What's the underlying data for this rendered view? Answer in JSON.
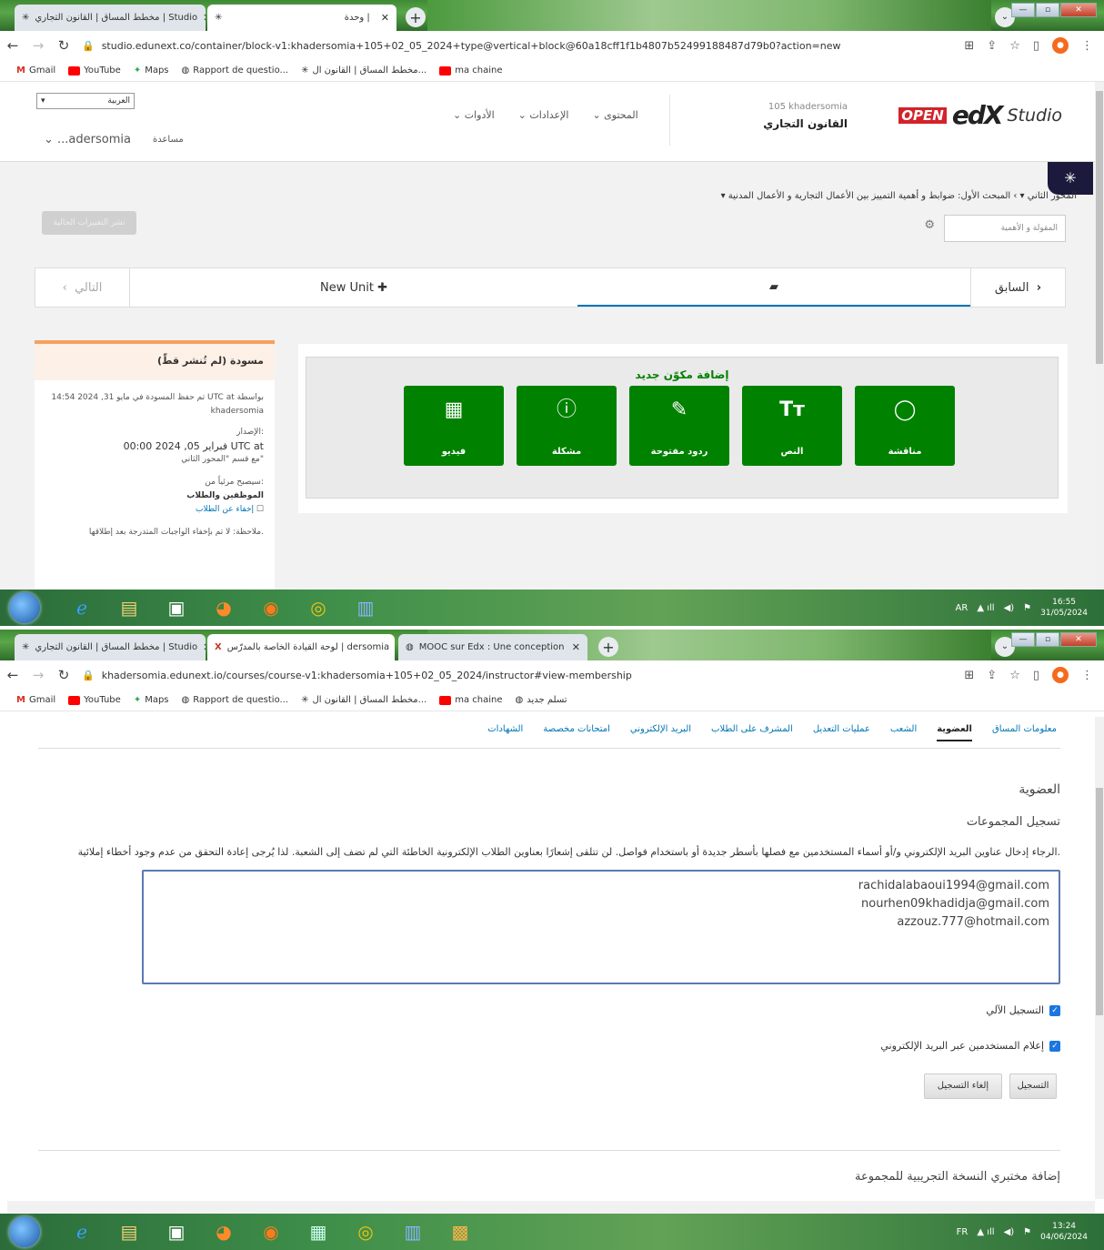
{
  "shot1": {
    "tabs": [
      {
        "label": "مخطط المساق | القانون التجاري | Studio"
      },
      {
        "label": "وحدة |"
      }
    ],
    "url": "studio.edunext.co/container/block-v1:khadersomia+105+02_05_2024+type@vertical+block@60a18cff1f1b4807b52499188487d79b0?action=new",
    "bookmarks": [
      "Gmail",
      "YouTube",
      "Maps",
      "Rapport de questio...",
      "مخطط المساق | القانون ال...",
      "ma chaine"
    ],
    "header": {
      "logo_open": "OPEN",
      "logo_edx": "edX",
      "logo_studio": "Studio",
      "course_number": "105 khadersomia",
      "course_title": "القانون التجاري",
      "menus": [
        "المحتوى",
        "الإعدادات",
        "الأدوات"
      ],
      "language": "العربية",
      "username": "...adersomia",
      "help": "مساعدة"
    },
    "breadcrumb": "المحور الثاني ▾  ›  المبحث الأول: ضوابط و أهمية التمييز بين الأعمال التجارية و الأعمال المدنية ▾",
    "name_placeholder": "المقولة و الأهمية",
    "publish_button": "نشر التغييرات الحالية",
    "unit_nav": {
      "previous": "السابق",
      "new_unit": "New Unit",
      "next": "التالي"
    },
    "side": {
      "title": "مسودة (لم تُنشر قطّ)",
      "saved": "تم حفظ المسودة في مايو 31, 2024 14:54 UTC at بواسطة",
      "author": "khadersomia",
      "release_label": "الإصدار:",
      "release_date": "فبراير 05, 2024 00:00 UTC at",
      "release_with": "مع قسم \"المحور الثاني\"",
      "visible_label": "سيصبح مرئياً من:",
      "visible_value": "الموظفين والطلاب",
      "hide_label": "إخفاء عن الطلاب",
      "note": "ملاحظة: لا تم بإخفاء الواجبات المتدرجة بعد إطلاقها."
    },
    "add_component": {
      "title": "إضافة مكوّن جديد",
      "buttons": [
        {
          "label": "فيديو",
          "icon": "film-icon"
        },
        {
          "label": "مشكلة",
          "icon": "question-icon"
        },
        {
          "label": "ردود مفتوحة",
          "icon": "edit-icon"
        },
        {
          "label": "النص",
          "icon": "text-icon"
        },
        {
          "label": "مناقشة",
          "icon": "chat-icon"
        }
      ]
    },
    "clock": {
      "lang": "AR",
      "time": "16:55",
      "date": "31/05/2024"
    }
  },
  "shot2": {
    "tabs": [
      {
        "label": "مخطط المساق | القانون التجاري | Studio"
      },
      {
        "label": "لوحة القيادة الخاصة بالمدرّس | dersomia"
      },
      {
        "label": "MOOC sur Edx : Une conception"
      }
    ],
    "url": "khadersomia.edunext.io/courses/course-v1:khadersomia+105+02_05_2024/instructor#view-membership",
    "bookmarks": [
      "Gmail",
      "YouTube",
      "Maps",
      "Rapport de questio...",
      "مخطط المساق | القانون ال...",
      "ma chaine",
      "تسلم جديد"
    ],
    "nav_tabs": [
      "معلومات المساق",
      "العضوية",
      "الشعب",
      "عمليات التعديل",
      "المشرف على الطلاب",
      "البريد الإلكتروني",
      "امتحانات مخصصة",
      "الشهادات"
    ],
    "heading": "العضوية",
    "subheading": "تسجيل المجموعات",
    "instructions": "الرجاء إدخال عناوين البريد الإلكتروني و/أو أسماء المستخدمين مع فصلها بأسطر جديدة أو باستخدام فواصل. لن تتلقى إشعارًا بعناوين الطلاب الإلكترونية الخاطئة التي لم تضف إلى الشعبة. لذا يُرجى إعادة التحقق من عدم وجود أخطاء إملائية.",
    "emails": [
      "rachidalabaoui1994@gmail.com",
      "nourhen09khadidja@gmail.com",
      "azzouz.777@hotmail.com"
    ],
    "auto_enroll": "التسجيل الآلي",
    "notify": "إعلام المستخدمين عبر البريد الإلكتروني",
    "enroll_button": "التسجيل",
    "unenroll_button": "إلغاء التسجيل",
    "beta_heading": "إضافة مختبري النسخة التجريبية للمجموعة",
    "clock": {
      "lang": "FR",
      "time": "13:24",
      "date": "04/06/2024"
    }
  },
  "colors": {
    "green": "#008100",
    "draft": "#f5a25d",
    "link": "#0075b4"
  }
}
